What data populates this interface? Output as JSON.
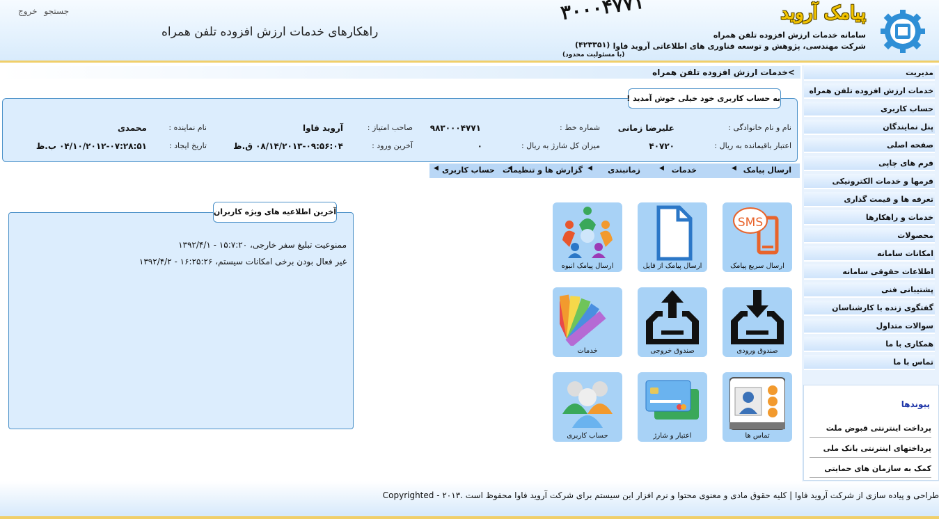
{
  "header": {
    "brand_title": "پیامک آروید",
    "brand_number": "۳۰۰۰۴۷۷۱",
    "line1": "سامانه خدمات ارزش افزوده تلفن همراه",
    "line2": "شرکت مهندسی، پژوهش و توسعه فناوری های اطلاعاتی آروید فاوا",
    "reg": "(۴۲۳۳۵۱)",
    "ltd": "(با مسئولیت محدود)",
    "tagline": "راهکارهای خدمات ارزش افزوده تلفن همراه",
    "search_label": "جستجو",
    "logout_label": "خروج"
  },
  "breadcrumb": ">خدمات ارزش افزوده تلفن همراه",
  "sidebar": {
    "items": [
      {
        "label": "مدیریت"
      },
      {
        "label": "خدمات ارزش افزوده تلفن همراه"
      },
      {
        "label": "حساب کاربری"
      },
      {
        "label": "پنل نمایندگان"
      },
      {
        "label": "صفحه اصلی"
      },
      {
        "label": "فرم های چاپی"
      },
      {
        "label": "فرمها و خدمات الکترونیکی"
      },
      {
        "label": "تعرفه ها و قیمت گذاری"
      },
      {
        "label": "خدمات و راهکارها"
      },
      {
        "label": "محصولات"
      },
      {
        "label": "امکانات سامانه"
      },
      {
        "label": "اطلاعات حقوقی سامانه"
      },
      {
        "label": "پشتیبانی فنی"
      },
      {
        "label": "گفتگوی زنده با کارشناسان"
      },
      {
        "label": "سوالات متداول"
      },
      {
        "label": "همکاری با ما"
      },
      {
        "label": "تماس با ما"
      }
    ],
    "links_title": "پیوندها",
    "links": [
      {
        "label": "پرداخت اینترنتی قبوض ملت"
      },
      {
        "label": "پرداختهای اینترنتی بانک ملی"
      },
      {
        "label": "کمک به سازمان های حمایتی"
      }
    ]
  },
  "account": {
    "welcome": "به حساب کاربری خود خیلی خوش آمدید !",
    "name_label": "نام و نام خانوادگی :",
    "name_value": "علیرضا زمانی",
    "line_label": "شماره خط :",
    "line_value": "۹۸۳۰۰۰۴۷۷۱",
    "owner_label": "صاحب امتیاز :",
    "owner_value": "آروید فاوا",
    "agent_label": "نام نماینده :",
    "agent_value": "محمدی",
    "credit_label": "اعتبار باقیمانده به ریال :",
    "credit_value": "۴۰۷۲۰",
    "charge_label": "میزان کل شارژ به ریال :",
    "charge_value": "۰",
    "last_login_label": "آخرین ورود :",
    "last_login_value": "۰۸/۱۴/۲۰۱۳-۰۹:۵۶:۰۴ ق.ظ",
    "created_label": "تاریخ ایجاد :",
    "created_value": "۰۴/۱۰/۲۰۱۲-۰۷:۲۸:۵۱ ب.ظ"
  },
  "menubar": {
    "items": [
      {
        "label": "ارسال پیامک"
      },
      {
        "label": "خدمات"
      },
      {
        "label": "زمانبندی"
      },
      {
        "label": "گزارش ها و تنظیمات"
      },
      {
        "label": "حساب کاربری"
      }
    ]
  },
  "tiles": [
    {
      "label": "ارسال سریع پیامک",
      "icon": "phone-sms-icon",
      "sms": "SMS"
    },
    {
      "label": "ارسال پیامک از فایل",
      "icon": "file-icon"
    },
    {
      "label": "ارسال پیامک انبوه",
      "icon": "group-people-icon"
    },
    {
      "label": "صندوق ورودی",
      "icon": "inbox-icon"
    },
    {
      "label": "صندوق خروجی",
      "icon": "outbox-icon"
    },
    {
      "label": "خدمات",
      "icon": "color-palette-icon"
    },
    {
      "label": "تماس ها",
      "icon": "contacts-icon"
    },
    {
      "label": "اعتبار و شارژ",
      "icon": "credit-card-icon"
    },
    {
      "label": "حساب کاربری",
      "icon": "users-icon"
    }
  ],
  "announcements": {
    "title": "آخرین اطلاعیه های ویژه کاربران",
    "items": [
      {
        "text": "ممنوعیت تبلیغ سفر خارجی، ۱۵:۷:۲۰ - ۱۳۹۲/۴/۱"
      },
      {
        "text": "غیر فعال بودن برخی امکانات سیستم، ۱۶:۲۵:۲۶ - ۱۳۹۲/۴/۲"
      }
    ]
  },
  "footer": {
    "text": "طراحی و پیاده سازی از شرکت آروید فاوا | کلیه حقوق مادی و معنوی محتوا و نرم افزار این سیستم برای شرکت آروید فاوا محفوظ است .۲۰۱۳ - Copyrighted"
  },
  "colors": {
    "accent": "#4a90c8",
    "brand_yellow": "#f3c400",
    "menubar": "#b9d7f6",
    "tile": "#a8d2f6"
  }
}
